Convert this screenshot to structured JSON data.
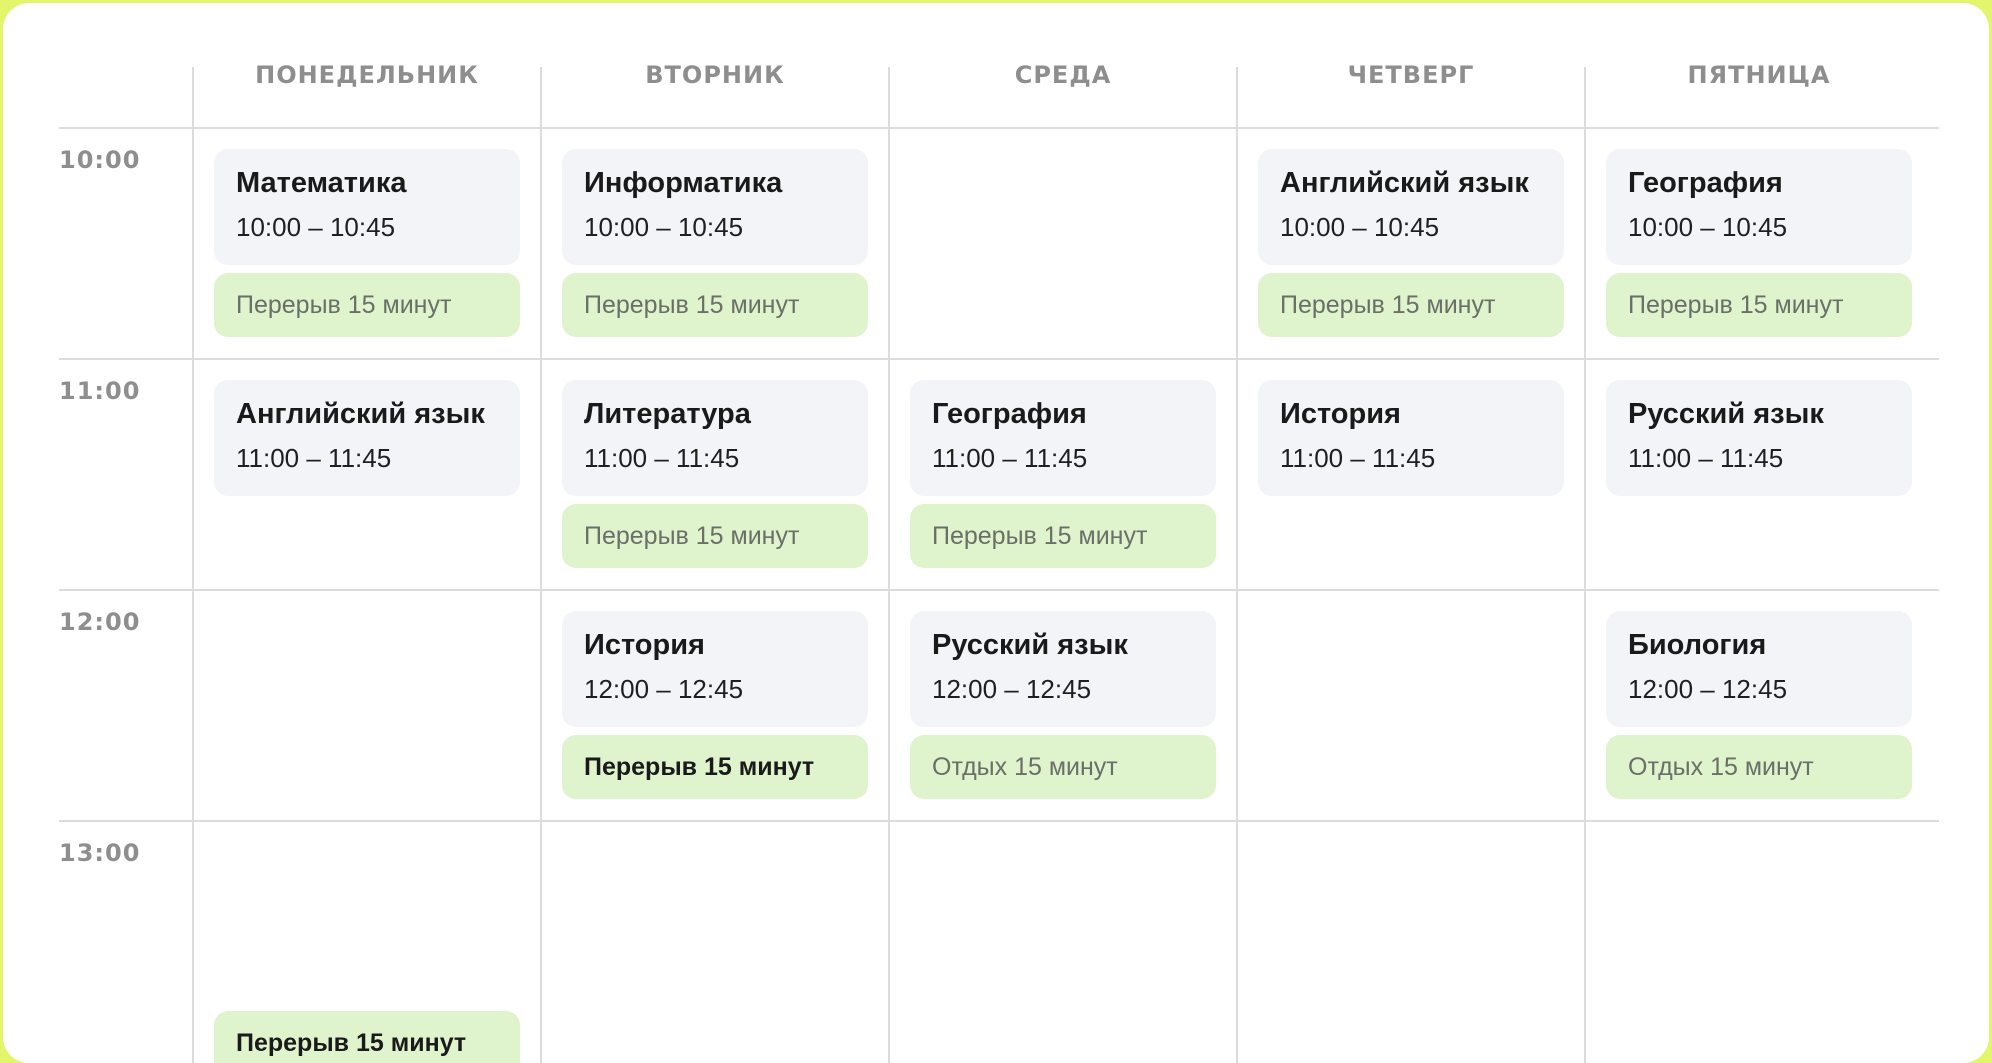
{
  "days": [
    "ПОНЕДЕЛЬНИК",
    "ВТОРНИК",
    "СРЕДА",
    "ЧЕТВЕРГ",
    "ПЯТНИЦА"
  ],
  "times": [
    "10:00",
    "11:00",
    "12:00",
    "13:00"
  ],
  "lessons": [
    {
      "title": "Математика",
      "time": "10:00 – 10:45"
    },
    {
      "title": "Информатика",
      "time": "10:00 – 10:45"
    },
    {
      "title": "Английский язык",
      "time": "10:00 – 10:45"
    },
    {
      "title": "География",
      "time": "10:00 – 10:45"
    },
    {
      "title": "Английский язык",
      "time": "11:00 – 11:45"
    },
    {
      "title": "Литература",
      "time": "11:00 – 11:45"
    },
    {
      "title": "География",
      "time": "11:00 – 11:45"
    },
    {
      "title": "История",
      "time": "11:00 – 11:45"
    },
    {
      "title": "Русский язык",
      "time": "11:00 – 11:45"
    },
    {
      "title": "История",
      "time": "12:00 – 12:45"
    },
    {
      "title": "Русский язык",
      "time": "12:00 – 12:45"
    },
    {
      "title": "Биология",
      "time": "12:00 – 12:45"
    }
  ],
  "breaks": [
    "Перерыв 15 минут",
    "Перерыв 15 минут",
    "Перерыв 15 минут",
    "Перерыв 15 минут",
    "Перерыв 15 минут",
    "Перерыв 15 минут",
    "Перерыв 15 минут",
    "Отдых 15 минут",
    "Отдых 15 минут",
    "Перерыв 15 минут"
  ]
}
